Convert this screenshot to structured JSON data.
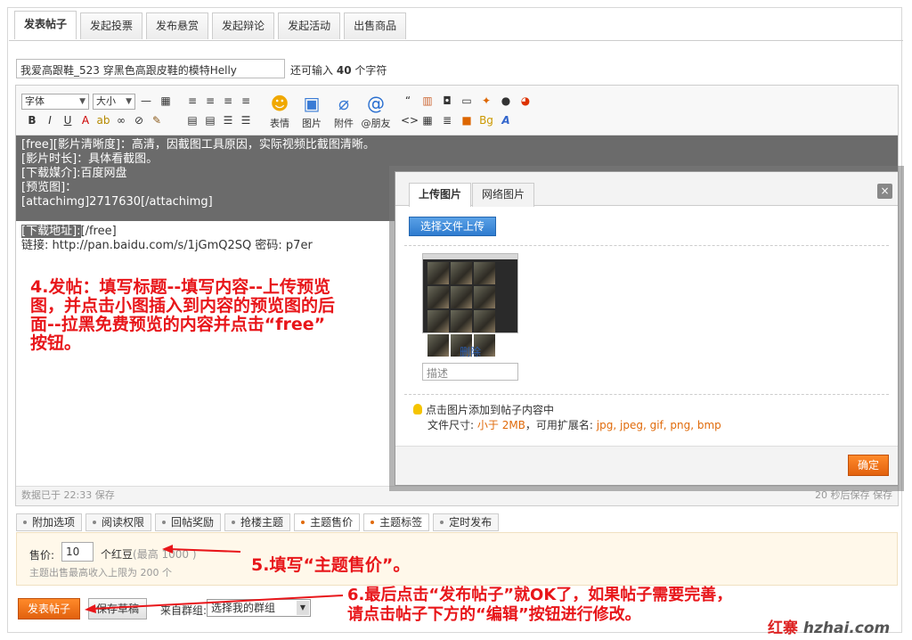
{
  "tabs": [
    "发表帖子",
    "发起投票",
    "发布悬赏",
    "发起辩论",
    "发起活动",
    "出售商品"
  ],
  "title": {
    "value": "我爱高跟鞋_523 穿黑色高跟皮鞋的模特Helly",
    "count_prefix": "还可输入",
    "count_value": "40",
    "count_suffix": "个字符"
  },
  "toolbar": {
    "font_label": "字体",
    "size_label": "大小",
    "emoji_label": "表情",
    "image_label": "图片",
    "attach_label": "附件",
    "at_label": "@朋友"
  },
  "content_lines": [
    "[free][影片清晰度]：高清，因截图工具原因，实际视频比截图清晰。",
    "[影片时长]：具体看截图。",
    "[下载媒介]:百度网盘",
    "[预览图]：",
    "[attachimg]2717630[/attachimg]",
    "",
    "[下载地址]:",
    "[/free]",
    "链接: http://pan.baidu.com/s/1jGmQ2SQ 密码: p7er"
  ],
  "annotations": {
    "step4": [
      "4.发帖：填写标题--填写内容--上传预览",
      "图，并点击小图插入到内容的预览图的后",
      "面--拉黑免费预览的内容并点击“free”",
      "按钮。"
    ],
    "step5": "5.填写“主题售价”。",
    "step6": [
      "6.最后点击“发布帖子”就OK了，如果帖子需要完善，",
      "请点击帖子下方的“编辑”按钮进行修改。"
    ]
  },
  "save_status": {
    "left": "数据已于 22:33 保存",
    "right": "20 秒后保存  保存"
  },
  "modal": {
    "tab_upload": "上传图片",
    "tab_web": "网络图片",
    "close_glyph": "×",
    "upload_button": "选择文件上传",
    "delete_link": "删除",
    "desc_placeholder": "描述",
    "tip": "点击图片添加到帖子内容中",
    "size_prefix": "文件尺寸:",
    "size_value": "小于 2MB",
    "ext_prefix": "，可用扩展名:",
    "ext_value": "jpg, jpeg, gif, png, bmp",
    "ok_button": "确定"
  },
  "option_tabs": [
    "附加选项",
    "阅读权限",
    "回帖奖励",
    "抢楼主题",
    "主题售价",
    "主题标签",
    "定时发布"
  ],
  "active_options": [
    "主题售价",
    "主题标签"
  ],
  "price": {
    "label": "售价:",
    "value": "10",
    "unit": "个红豆",
    "max_hint": "(最高 1000 )",
    "note": "主题出售最高收入上限为 200 个"
  },
  "bottom": {
    "submit": "发表帖子",
    "draft": "保存草稿",
    "group_label": "来自群组:",
    "group_select": "选择我的群组"
  },
  "watermark": {
    "mark": "红寨",
    "site": "hzhai.com"
  },
  "colors": {
    "accent_orange": "#e2610e",
    "annotation_red": "#e8161a",
    "selection_gray": "#6b6b6b",
    "link_blue": "#2a5db0"
  }
}
